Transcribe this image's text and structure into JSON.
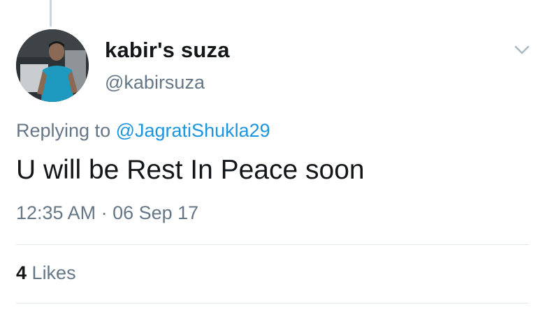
{
  "tweet": {
    "display_name": "kabir's suza",
    "handle": "@kabirsuza",
    "reply_prefix": "Replying to",
    "reply_mention": "@JagratiShukla29",
    "text": "U will be Rest In Peace soon",
    "timestamp": "12:35 AM · 06 Sep 17",
    "likes_count": "4",
    "likes_label": "Likes"
  },
  "icons": {
    "menu": "chevron-down-icon",
    "avatar": "profile-photo"
  },
  "colors": {
    "name_text": "#14171a",
    "secondary_text": "#657786",
    "link": "#1b95e0",
    "divider": "#e1e8ed",
    "thread_line": "#ccd6dd"
  }
}
